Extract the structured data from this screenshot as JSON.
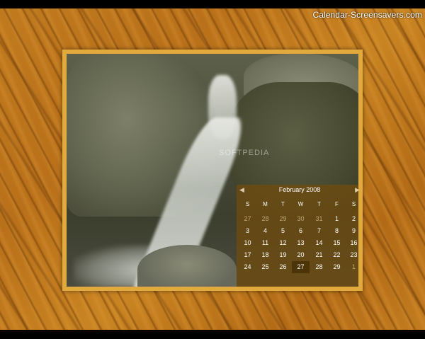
{
  "brand": "Calendar-Screensavers.com",
  "watermark": "SOFTPEDIA",
  "calendar": {
    "month_label": "February 2008",
    "prev_icon": "chevron-left-icon",
    "next_icon": "chevron-right-icon",
    "weekdays": [
      "S",
      "M",
      "T",
      "W",
      "T",
      "F",
      "S"
    ],
    "weeks": [
      [
        "27",
        "28",
        "29",
        "30",
        "31",
        "1",
        "2"
      ],
      [
        "3",
        "4",
        "5",
        "6",
        "7",
        "8",
        "9"
      ],
      [
        "10",
        "11",
        "12",
        "13",
        "14",
        "15",
        "16"
      ],
      [
        "17",
        "18",
        "19",
        "20",
        "21",
        "22",
        "23"
      ],
      [
        "24",
        "25",
        "26",
        "27",
        "28",
        "29",
        "1"
      ]
    ],
    "today": "27",
    "colors": {
      "frame": "#e2a93c",
      "panel": "#6e4b0f"
    }
  }
}
